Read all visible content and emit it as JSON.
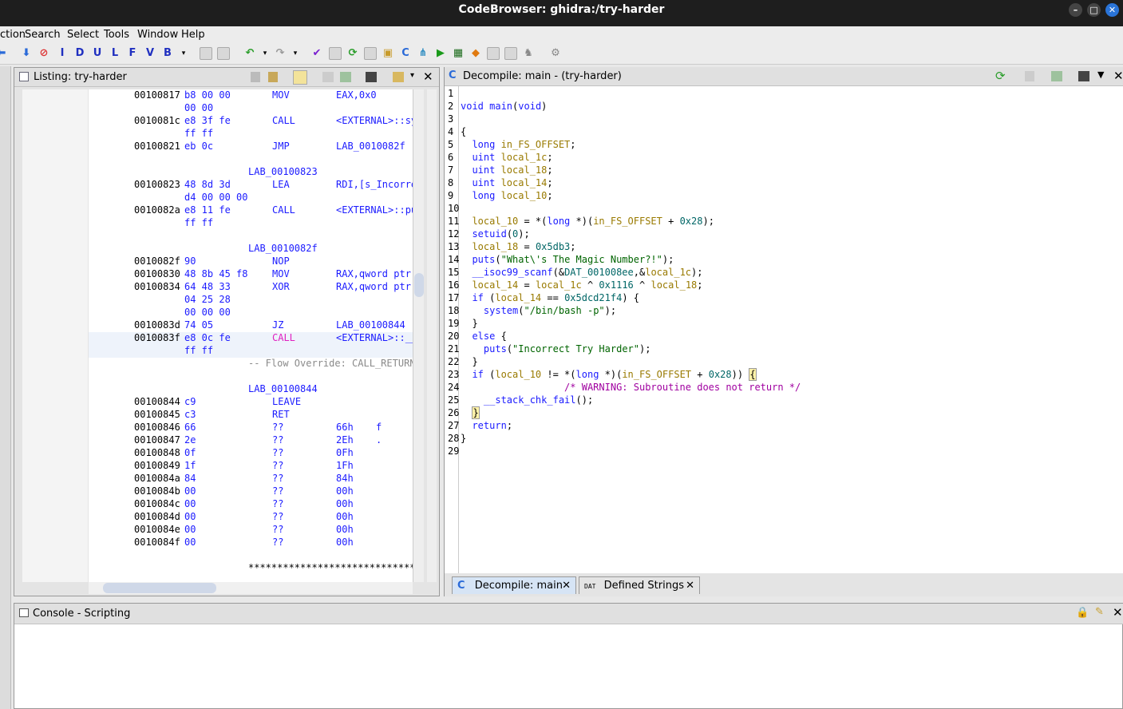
{
  "window": {
    "title": "CodeBrowser: ghidra:/try-harder"
  },
  "menu": [
    "ction",
    "Search",
    "Select",
    "Tools",
    "Window",
    "Help"
  ],
  "toolbar": {
    "letters": [
      "I",
      "D",
      "U",
      "L",
      "F",
      "V",
      "B"
    ]
  },
  "listing": {
    "title": "Listing:  try-harder",
    "rows": [
      {
        "addr": "00100817",
        "bytes": "b8 00 00",
        "mn": "MOV",
        "op": "EAX,0x0"
      },
      {
        "addr": "",
        "bytes": "00 00",
        "mn": "",
        "op": ""
      },
      {
        "addr": "0010081c",
        "bytes": "e8 3f fe",
        "mn": "CALL",
        "op": "<EXTERNAL>::sy"
      },
      {
        "addr": "",
        "bytes": "ff ff",
        "mn": "",
        "op": ""
      },
      {
        "addr": "00100821",
        "bytes": "eb 0c",
        "mn": "JMP",
        "op": "LAB_0010082f"
      },
      {
        "addr": "",
        "bytes": "",
        "mn": "",
        "op": ""
      },
      {
        "label": "LAB_00100823"
      },
      {
        "addr": "00100823",
        "bytes": "48 8d 3d",
        "mn": "LEA",
        "op": "RDI,[s_Incorre"
      },
      {
        "addr": "",
        "bytes": "d4 00 00 00",
        "mn": "",
        "op": ""
      },
      {
        "addr": "0010082a",
        "bytes": "e8 11 fe",
        "mn": "CALL",
        "op": "<EXTERNAL>::pu"
      },
      {
        "addr": "",
        "bytes": "ff ff",
        "mn": "",
        "op": ""
      },
      {
        "addr": "",
        "bytes": "",
        "mn": "",
        "op": ""
      },
      {
        "label": "LAB_0010082f"
      },
      {
        "addr": "0010082f",
        "bytes": "90",
        "mn": "NOP",
        "op": ""
      },
      {
        "addr": "00100830",
        "bytes": "48 8b 45 f8",
        "mn": "MOV",
        "op": "RAX,qword ptr"
      },
      {
        "addr": "00100834",
        "bytes": "64 48 33",
        "mn": "XOR",
        "op": "RAX,qword ptr"
      },
      {
        "addr": "",
        "bytes": "04 25 28",
        "mn": "",
        "op": ""
      },
      {
        "addr": "",
        "bytes": "00 00 00",
        "mn": "",
        "op": ""
      },
      {
        "addr": "0010083d",
        "bytes": "74 05",
        "mn": "JZ",
        "op": "LAB_00100844"
      },
      {
        "addr": "0010083f",
        "bytes": "e8 0c fe",
        "mn": "CALL",
        "op": "<EXTERNAL>::__",
        "hl": true
      },
      {
        "addr": "",
        "bytes": "ff ff",
        "mn": "",
        "op": "",
        "hl": true
      },
      {
        "override": "-- Flow Override: CALL_RETURN"
      },
      {
        "addr": "",
        "bytes": "",
        "mn": "",
        "op": ""
      },
      {
        "label": "LAB_00100844"
      },
      {
        "addr": "00100844",
        "bytes": "c9",
        "mn": "LEAVE",
        "op": ""
      },
      {
        "addr": "00100845",
        "bytes": "c3",
        "mn": "RET",
        "op": ""
      },
      {
        "addr": "00100846",
        "bytes": "66",
        "mn": "??",
        "op": "66h",
        "ch": "f"
      },
      {
        "addr": "00100847",
        "bytes": "2e",
        "mn": "??",
        "op": "2Eh",
        "ch": "."
      },
      {
        "addr": "00100848",
        "bytes": "0f",
        "mn": "??",
        "op": "0Fh",
        "ch": ""
      },
      {
        "addr": "00100849",
        "bytes": "1f",
        "mn": "??",
        "op": "1Fh",
        "ch": ""
      },
      {
        "addr": "0010084a",
        "bytes": "84",
        "mn": "??",
        "op": "84h",
        "ch": ""
      },
      {
        "addr": "0010084b",
        "bytes": "00",
        "mn": "??",
        "op": "00h",
        "ch": ""
      },
      {
        "addr": "0010084c",
        "bytes": "00",
        "mn": "??",
        "op": "00h",
        "ch": ""
      },
      {
        "addr": "0010084d",
        "bytes": "00",
        "mn": "??",
        "op": "00h",
        "ch": ""
      },
      {
        "addr": "0010084e",
        "bytes": "00",
        "mn": "??",
        "op": "00h",
        "ch": ""
      },
      {
        "addr": "0010084f",
        "bytes": "00",
        "mn": "??",
        "op": "00h",
        "ch": ""
      },
      {
        "addr": "",
        "bytes": "",
        "mn": "",
        "op": ""
      },
      {
        "stars": "******************************"
      }
    ]
  },
  "decompile": {
    "title": "Decompile: main -  (try-harder)",
    "lines": [
      [],
      [
        [
          "ty",
          "void "
        ],
        [
          "fn",
          "main"
        ],
        [
          "",
          "("
        ],
        [
          "ty",
          "void"
        ],
        [
          "",
          ")"
        ]
      ],
      [],
      [
        [
          "",
          "{"
        ]
      ],
      [
        [
          "",
          "  "
        ],
        [
          "ty",
          "long "
        ],
        [
          "var",
          "in_FS_OFFSET"
        ],
        [
          "",
          ";"
        ]
      ],
      [
        [
          "",
          "  "
        ],
        [
          "ty",
          "uint "
        ],
        [
          "var",
          "local_1c"
        ],
        [
          "",
          ";"
        ]
      ],
      [
        [
          "",
          "  "
        ],
        [
          "ty",
          "uint "
        ],
        [
          "var",
          "local_18"
        ],
        [
          "",
          ";"
        ]
      ],
      [
        [
          "",
          "  "
        ],
        [
          "ty",
          "uint "
        ],
        [
          "var",
          "local_14"
        ],
        [
          "",
          ";"
        ]
      ],
      [
        [
          "",
          "  "
        ],
        [
          "ty",
          "long "
        ],
        [
          "var",
          "local_10"
        ],
        [
          "",
          ";"
        ]
      ],
      [],
      [
        [
          "",
          "  "
        ],
        [
          "var",
          "local_10"
        ],
        [
          "",
          " = *("
        ],
        [
          "ty",
          "long"
        ],
        [
          "",
          " *)("
        ],
        [
          "var",
          "in_FS_OFFSET"
        ],
        [
          "",
          " + "
        ],
        [
          "num",
          "0x28"
        ],
        [
          "",
          ");"
        ]
      ],
      [
        [
          "",
          "  "
        ],
        [
          "fn",
          "setuid"
        ],
        [
          "",
          "("
        ],
        [
          "num",
          "0"
        ],
        [
          "",
          ");"
        ]
      ],
      [
        [
          "",
          "  "
        ],
        [
          "var",
          "local_18"
        ],
        [
          "",
          " = "
        ],
        [
          "num",
          "0x5db3"
        ],
        [
          "",
          ";"
        ]
      ],
      [
        [
          "",
          "  "
        ],
        [
          "fn",
          "puts"
        ],
        [
          "",
          "("
        ],
        [
          "str",
          "\"What\\'s The Magic Number?!\""
        ],
        [
          "",
          ");"
        ]
      ],
      [
        [
          "",
          "  "
        ],
        [
          "fn",
          "__isoc99_scanf"
        ],
        [
          "",
          "(&"
        ],
        [
          "num",
          "DAT_001008ee"
        ],
        [
          "",
          ",&"
        ],
        [
          "var",
          "local_1c"
        ],
        [
          "",
          ");"
        ]
      ],
      [
        [
          "",
          "  "
        ],
        [
          "var",
          "local_14"
        ],
        [
          "",
          " = "
        ],
        [
          "var",
          "local_1c"
        ],
        [
          "",
          " ^ "
        ],
        [
          "num",
          "0x1116"
        ],
        [
          "",
          " ^ "
        ],
        [
          "var",
          "local_18"
        ],
        [
          "",
          ";"
        ]
      ],
      [
        [
          "",
          "  "
        ],
        [
          "kw",
          "if"
        ],
        [
          "",
          " ("
        ],
        [
          "var",
          "local_14"
        ],
        [
          "",
          " == "
        ],
        [
          "num",
          "0x5dcd21f4"
        ],
        [
          "",
          ") {"
        ]
      ],
      [
        [
          "",
          "    "
        ],
        [
          "fn",
          "system"
        ],
        [
          "",
          "("
        ],
        [
          "str",
          "\"/bin/bash -p\""
        ],
        [
          "",
          ");"
        ]
      ],
      [
        [
          "",
          "  }"
        ]
      ],
      [
        [
          "",
          "  "
        ],
        [
          "kw",
          "else"
        ],
        [
          "",
          " {"
        ]
      ],
      [
        [
          "",
          "    "
        ],
        [
          "fn",
          "puts"
        ],
        [
          "",
          "("
        ],
        [
          "str",
          "\"Incorrect Try Harder\""
        ],
        [
          "",
          ");"
        ]
      ],
      [
        [
          "",
          "  }"
        ]
      ],
      [
        [
          "",
          "  "
        ],
        [
          "kw",
          "if"
        ],
        [
          "",
          " ("
        ],
        [
          "var",
          "local_10"
        ],
        [
          "",
          " != *("
        ],
        [
          "ty",
          "long"
        ],
        [
          "",
          " *)("
        ],
        [
          "var",
          "in_FS_OFFSET"
        ],
        [
          "",
          " + "
        ],
        [
          "num",
          "0x28"
        ],
        [
          "",
          ")) "
        ],
        [
          "hl",
          "{"
        ]
      ],
      [
        [
          "",
          "                  "
        ],
        [
          "cm",
          "/* WARNING: Subroutine does not return */"
        ]
      ],
      [
        [
          "",
          "    "
        ],
        [
          "fn",
          "__stack_chk_fail"
        ],
        [
          "",
          "();"
        ]
      ],
      [
        [
          "",
          "  "
        ],
        [
          "hl",
          "}"
        ]
      ],
      [
        [
          "",
          "  "
        ],
        [
          "kw",
          "return"
        ],
        [
          "",
          ";"
        ]
      ],
      [
        [
          "",
          "}"
        ]
      ],
      []
    ]
  },
  "tabs": [
    {
      "label": "Decompile: main",
      "active": true
    },
    {
      "label": "Defined Strings",
      "active": false
    }
  ],
  "console": {
    "title": "Console - Scripting"
  },
  "colors": {
    "titlebar": "#1e1e1e",
    "keyword": "#1b1bff",
    "variable": "#997a00",
    "string": "#006400",
    "comment": "#a000a0",
    "highlight": "#fff2a8"
  }
}
